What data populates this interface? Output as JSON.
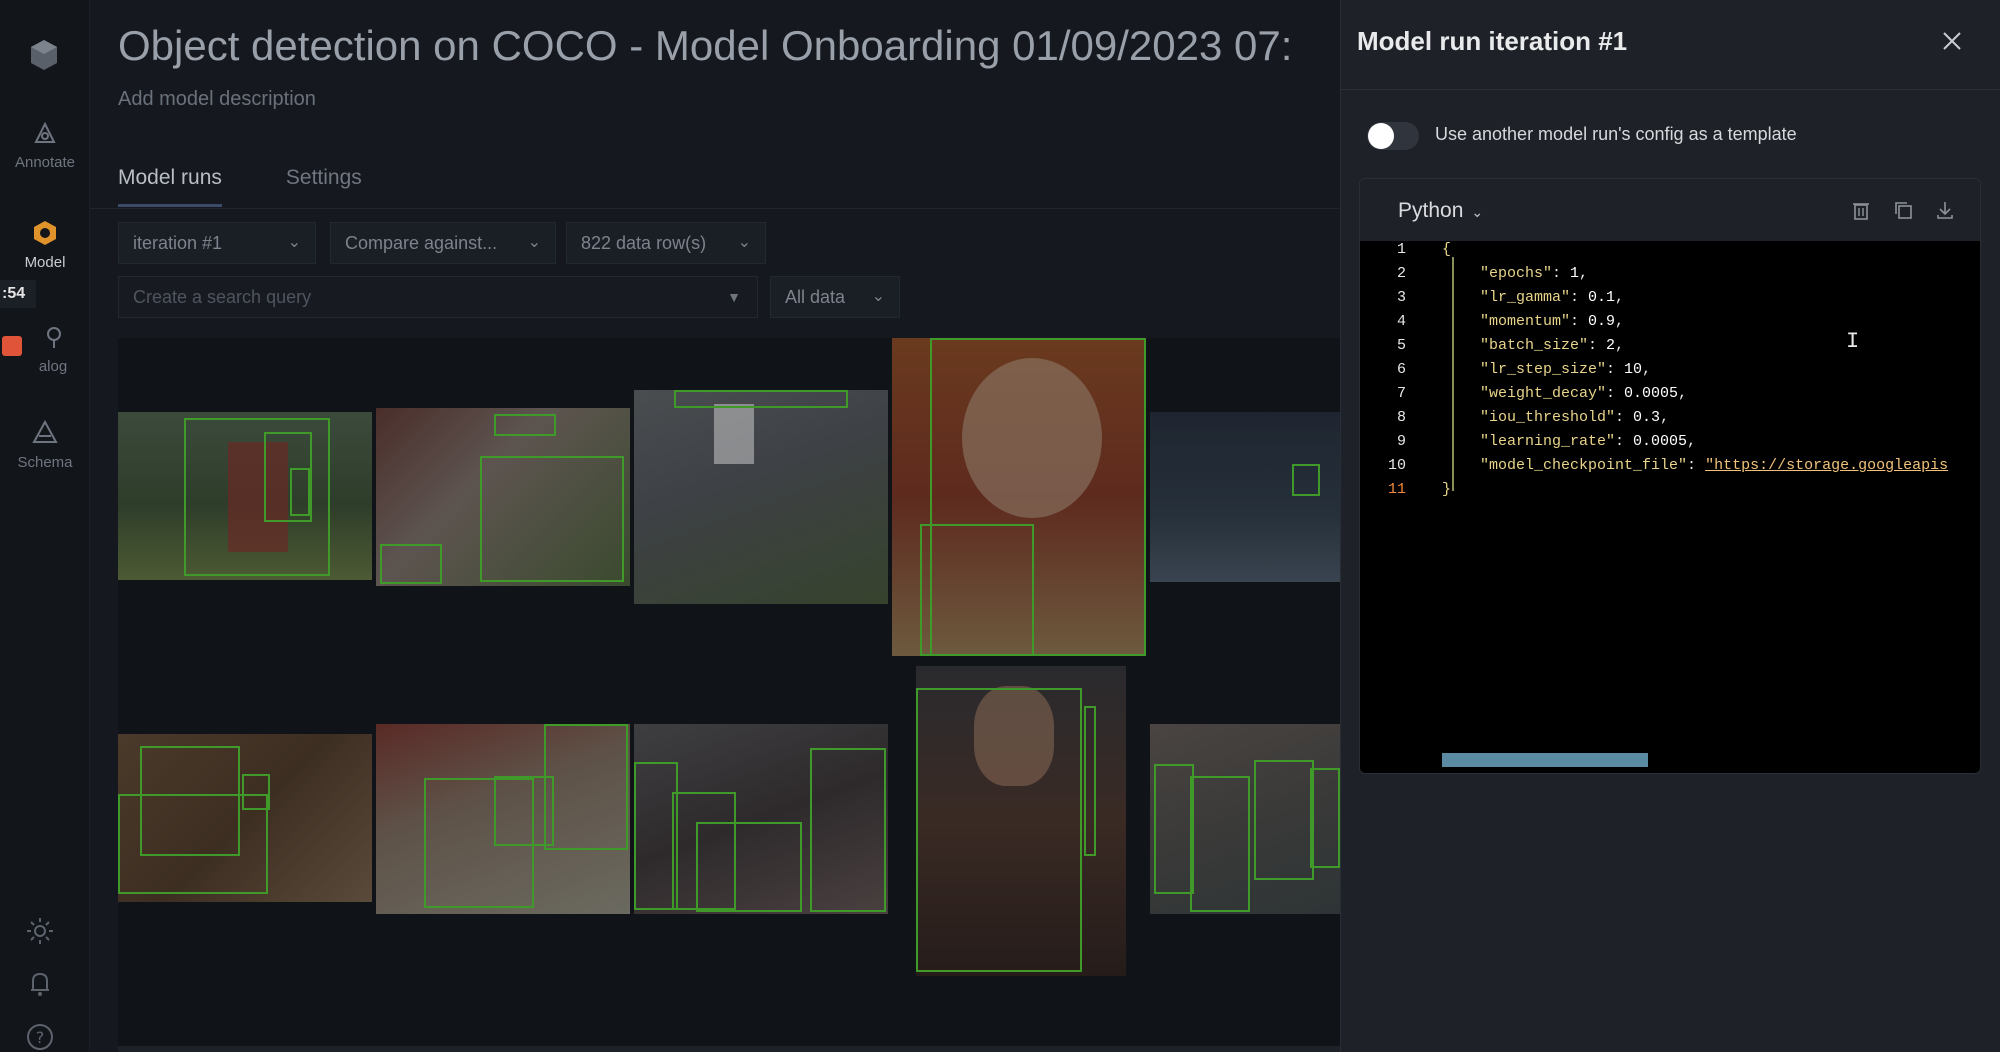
{
  "rail": {
    "items": [
      {
        "label": "Annotate",
        "icon": "annotate-icon"
      },
      {
        "label": "Model",
        "icon": "model-icon"
      },
      {
        "label": "alog",
        "icon": "catalog-icon"
      },
      {
        "label": "Schema",
        "icon": "schema-icon"
      }
    ],
    "timer": ":54",
    "bottom_icons": [
      "sun-icon",
      "bell-icon",
      "help-icon"
    ]
  },
  "main": {
    "title": "Object detection on COCO - Model Onboarding 01/09/2023 07:",
    "description_placeholder": "Add model description",
    "tabs": [
      {
        "label": "Model runs",
        "active": true
      },
      {
        "label": "Settings",
        "active": false
      }
    ],
    "filters": {
      "iteration": "iteration #1",
      "compare": "Compare against...",
      "rows": "822 data row(s)",
      "search_placeholder": "Create a search query",
      "data_filter": "All data"
    }
  },
  "panel": {
    "title": "Model run iteration #1",
    "toggle_label": "Use another model run's config as a template",
    "toggle_on": false,
    "editor": {
      "language": "Python",
      "toolbar_icons": [
        "trash-icon",
        "copy-icon",
        "download-icon"
      ],
      "line_numbers": [
        "1",
        "2",
        "3",
        "4",
        "5",
        "6",
        "7",
        "8",
        "9",
        "10",
        "11"
      ],
      "open_brace": "{",
      "close_brace": "}",
      "lines": [
        {
          "key": "\"epochs\"",
          "value": "1"
        },
        {
          "key": "\"lr_gamma\"",
          "value": "0.1"
        },
        {
          "key": "\"momentum\"",
          "value": "0.9"
        },
        {
          "key": "\"batch_size\"",
          "value": "2"
        },
        {
          "key": "\"lr_step_size\"",
          "value": "10"
        },
        {
          "key": "\"weight_decay\"",
          "value": "0.0005"
        },
        {
          "key": "\"iou_threshold\"",
          "value": "0.3"
        },
        {
          "key": "\"learning_rate\"",
          "value": "0.0005"
        },
        {
          "key": "\"model_checkpoint_file\"",
          "value": "\"https://storage.googleapis"
        }
      ],
      "cursor_glyph": "I"
    }
  },
  "colors": {
    "panel_bg": "#1e2127",
    "code_bg": "#000000",
    "bbox": "#3f9a2a",
    "model_icon": "#e0932a",
    "record": "#e0553a",
    "scrollbar": "#5b8aa3"
  }
}
